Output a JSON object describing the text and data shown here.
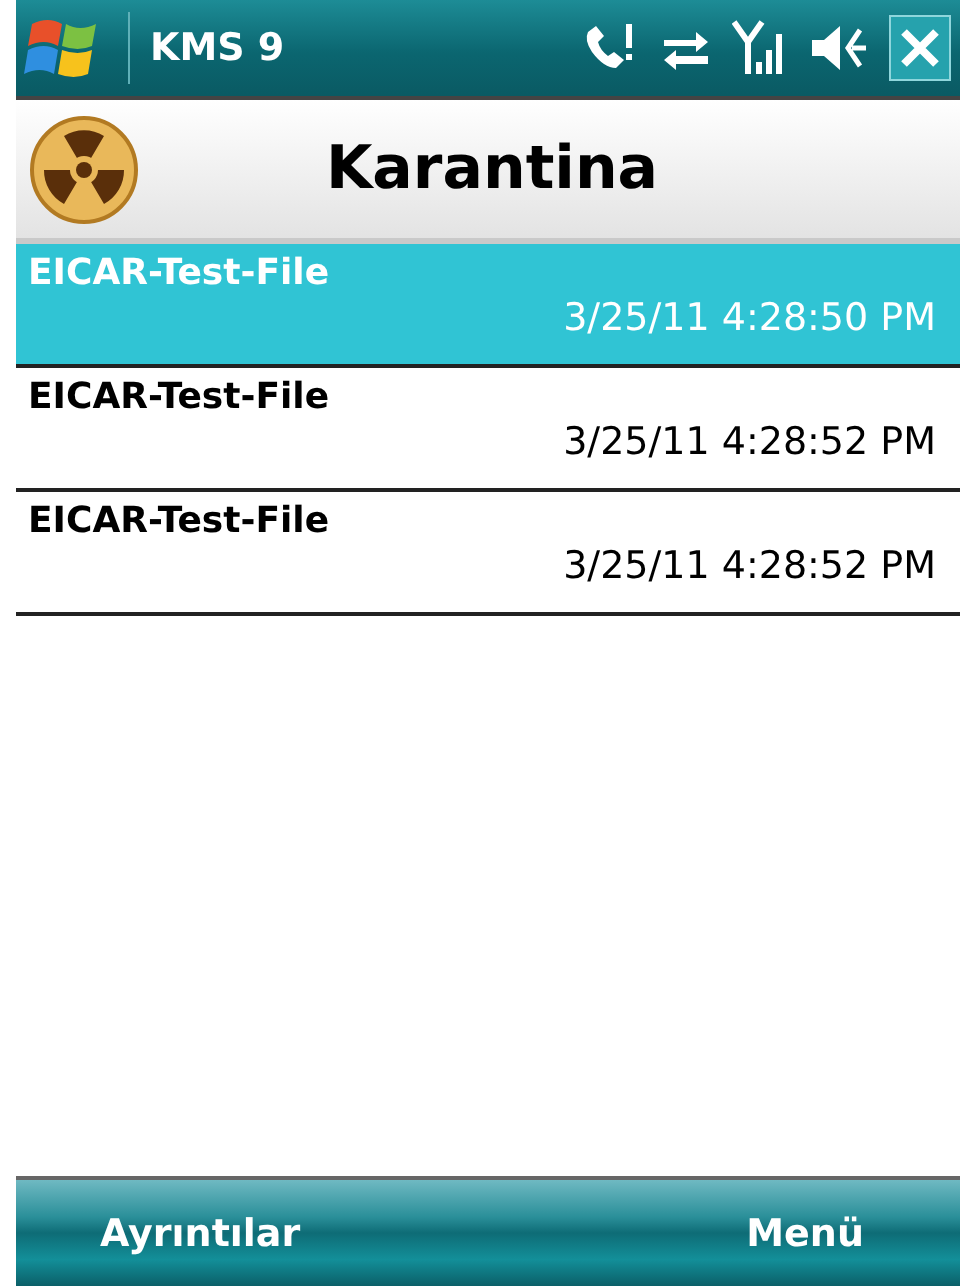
{
  "status_bar": {
    "title": "KMS 9"
  },
  "header": {
    "title": "Karantina"
  },
  "items": [
    {
      "name": "EICAR-Test-File",
      "time": "3/25/11 4:28:50 PM",
      "selected": true
    },
    {
      "name": "EICAR-Test-File",
      "time": "3/25/11 4:28:52 PM",
      "selected": false
    },
    {
      "name": "EICAR-Test-File",
      "time": "3/25/11 4:28:52 PM",
      "selected": false
    }
  ],
  "soft_keys": {
    "left": "Ayrıntılar",
    "right": "Menü"
  }
}
